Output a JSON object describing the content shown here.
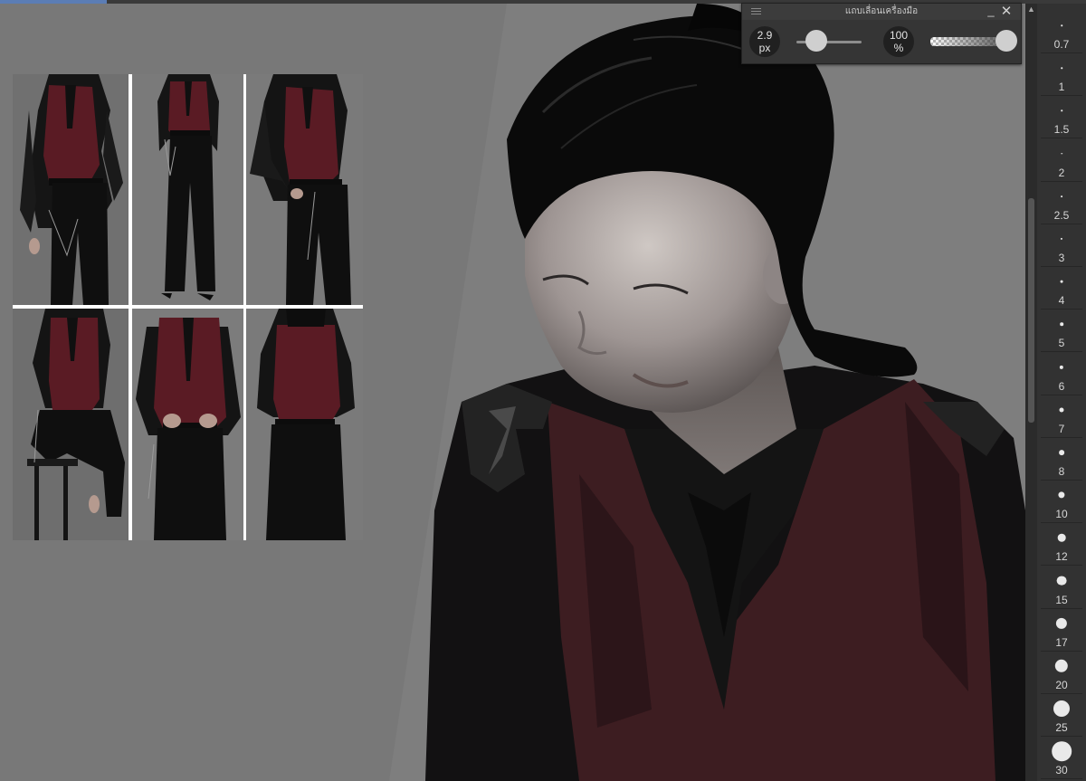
{
  "tool_window": {
    "title": "แถบเลื่อนเครื่องมือ",
    "minimize_label": "_",
    "close_label": "✕",
    "brush_size": {
      "value": "2.9",
      "unit": "px",
      "level": 0.3
    },
    "opacity": {
      "value": "100",
      "unit": "%",
      "level": 1.0
    }
  },
  "brush_sizes": [
    "0.7",
    "1",
    "1.5",
    "2",
    "2.5",
    "3",
    "4",
    "5",
    "6",
    "7",
    "8",
    "10",
    "12",
    "15",
    "17",
    "20",
    "25",
    "30"
  ],
  "icons": {
    "menu": "hamburger-icon",
    "scroll_up": "chevron-up-icon"
  },
  "colors": {
    "canvas_bg": "#787878",
    "panel_bg": "#323232",
    "vest": "#4e1a21",
    "shirt": "#111111"
  }
}
